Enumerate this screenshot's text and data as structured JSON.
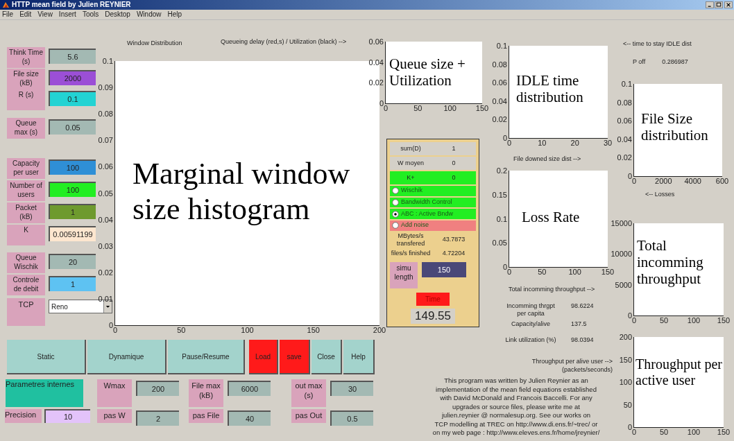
{
  "window": {
    "title": "HTTP mean field by Julien REYNIER"
  },
  "menu": [
    "File",
    "Edit",
    "View",
    "Insert",
    "Tools",
    "Desktop",
    "Window",
    "Help"
  ],
  "parameters": [
    {
      "label": "Think Time (s)",
      "value": "5.6",
      "color": "#a3b9b3"
    },
    {
      "label": "File size (kB)",
      "value": "2000",
      "color": "#9b4fd6"
    },
    {
      "label": "R (s)",
      "value": "0.1",
      "color": "#22d3d3"
    },
    {
      "label": "Queue max (s)",
      "value": "0.05",
      "color": "#a3b9b3"
    },
    {
      "label": "Capacity per user",
      "value": "100",
      "color": "#2f8fd6"
    },
    {
      "label": "Number of users",
      "value": "100",
      "color": "#22ee22"
    },
    {
      "label": "Packet (kB)",
      "value": "1",
      "color": "#6e9a2e"
    },
    {
      "label": "K",
      "value": "0.00591199",
      "color": "#fde6cf"
    },
    {
      "label": "Queue Wischik",
      "value": "20",
      "color": "#a3b9b3"
    },
    {
      "label": "Controle de debit",
      "value": "1",
      "color": "#5ec2f2"
    }
  ],
  "tcp": {
    "label": "TCP",
    "value": "Reno"
  },
  "titles": {
    "window_distribution": "Window Distribution",
    "queueing": "Queueing delay (red,s) / Utilization (black) -->"
  },
  "plots": [
    {
      "caption": "Marginal window size histogram",
      "yticks": [
        "0.1",
        "0.09",
        "0.08",
        "0.07",
        "0.06",
        "0.05",
        "0.04",
        "0.03",
        "0.02",
        "0.01",
        "0"
      ],
      "xticks": [
        "0",
        "50",
        "100",
        "150",
        "200"
      ]
    },
    {
      "caption": "Queue size + Utilization",
      "yticks": [
        "0.06",
        "0.04",
        "0.02",
        "0"
      ],
      "xticks": [
        "0",
        "50",
        "100",
        "150"
      ]
    },
    {
      "caption": "IDLE time distribution",
      "yticks": [
        "0.1",
        "0.08",
        "0.06",
        "0.04",
        "0.02",
        "0"
      ],
      "xticks": [
        "0",
        "10",
        "20",
        "30"
      ]
    },
    {
      "caption": "File Size distribution",
      "yticks": [
        "0.1",
        "0.08",
        "0.06",
        "0.04",
        "0.02",
        "0"
      ],
      "xticks": [
        "0",
        "2000",
        "4000",
        "600"
      ]
    },
    {
      "caption": "Loss Rate",
      "yticks": [
        "0.2",
        "0.15",
        "0.1",
        "0.05",
        "0"
      ],
      "xticks": [
        "0",
        "50",
        "100",
        "150"
      ]
    },
    {
      "caption": "Total incomming throughput",
      "yticks": [
        "15000",
        "10000",
        "5000",
        "0"
      ],
      "xticks": [
        "0",
        "50",
        "100",
        "150"
      ]
    },
    {
      "caption": "Throughput per active user",
      "yticks": [
        "200",
        "150",
        "100",
        "50",
        "0"
      ],
      "xticks": [
        "0",
        "50",
        "100",
        "150"
      ]
    }
  ],
  "panel": {
    "stats": [
      {
        "label": "sum(D)",
        "value": "1",
        "color": "#d4d0c8"
      },
      {
        "label": "W moyen",
        "value": "0",
        "color": "#d4d0c8"
      },
      {
        "label": "K+",
        "value": "0",
        "color": "#22ee22"
      }
    ],
    "options": [
      {
        "label": "Wischik",
        "selected": false,
        "color": "#22ee22"
      },
      {
        "label": "Bandwidth Control",
        "selected": false,
        "color": "#22ee22"
      },
      {
        "label": "ABC : Active Bndw",
        "selected": true,
        "color": "#22ee22"
      },
      {
        "label": "Add noise",
        "selected": false,
        "color": "#f08080"
      }
    ],
    "readings": [
      {
        "label": "MBytes/s transfered",
        "value": "43.7873"
      },
      {
        "label": "files/s finished",
        "value": "4.72204"
      }
    ],
    "simu_length": {
      "label": "simu length",
      "value": "150"
    },
    "time_button": "Time",
    "time_value": "149.55"
  },
  "annotations": [
    "<-- time to stay IDLE dist",
    "File downed size dist -->",
    "<-- Losses",
    "Total incomming throughput -->",
    "Throughput per alive user -->\n(packets/seconds)"
  ],
  "p_off": {
    "label": "P off",
    "value": "0.286987"
  },
  "readouts": [
    {
      "label": "Incomming thrgpt\nper capita",
      "value": "98.6224"
    },
    {
      "label": "Capacity/alive",
      "value": "137.5"
    },
    {
      "label": "Link utilization (%)",
      "value": "98.0394"
    }
  ],
  "about": "This program was written by Julien Reynier as an\nimplementation of the mean field equations established\nwith David McDonald and Francois Baccelli.  For any\nupgrades or source files, please write me at\njulien.reynier @ normalesup.org. See our works on\nTCP modelling at TREC on http://www.di.ens.fr/~trec/ or\non my web page : http://www.eleves.ens.fr/home/jreynier/",
  "buttons": [
    {
      "label": "Static",
      "color": "#a3d3cc"
    },
    {
      "label": "Dynamique",
      "color": "#a3d3cc"
    },
    {
      "label": "Pause/Resume",
      "color": "#a3d3cc"
    },
    {
      "label": "Load",
      "color": "#ff1a1a"
    },
    {
      "label": "save",
      "color": "#ff1a1a"
    },
    {
      "label": "Close",
      "color": "#a3d3cc"
    },
    {
      "label": "Help",
      "color": "#a3d3cc"
    }
  ],
  "internal": {
    "title": "Parametres internes",
    "precision": {
      "label": "Precision",
      "value": "10"
    },
    "fields": [
      {
        "label": "Wmax",
        "value": "200"
      },
      {
        "label": "pas W",
        "value": "2"
      },
      {
        "label": "File max (kB)",
        "value": "6000"
      },
      {
        "label": "pas File",
        "value": "40"
      },
      {
        "label": "out max (s)",
        "value": "30"
      },
      {
        "label": "pas Out",
        "value": "0.5"
      }
    ]
  }
}
